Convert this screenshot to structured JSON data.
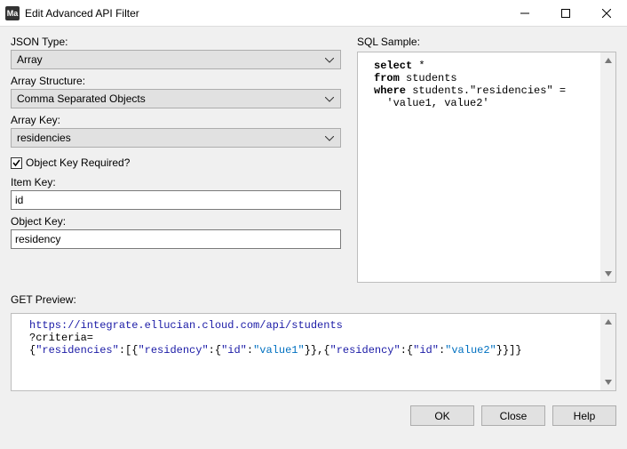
{
  "window": {
    "app_icon_text": "Ma",
    "title": "Edit Advanced API Filter"
  },
  "labels": {
    "json_type": "JSON Type:",
    "array_structure": "Array Structure:",
    "array_key": "Array Key:",
    "object_key_required": "Object Key Required?",
    "item_key": "Item Key:",
    "object_key": "Object Key:",
    "sql_sample": "SQL Sample:",
    "get_preview": "GET Preview:"
  },
  "fields": {
    "json_type": "Array",
    "array_structure": "Comma Separated Objects",
    "array_key": "residencies",
    "object_key_required_checked": true,
    "item_key": "id",
    "object_key": "residency"
  },
  "sql_sample": {
    "line1_kw": "select",
    "line1_rest": " *",
    "line2_kw": "from",
    "line2_rest": " students",
    "line3_kw": "where",
    "line3_rest": " students.\"residencies\" =",
    "line4": "  'value1, value2'"
  },
  "get_preview": {
    "base_url": "https://integrate.ellucian.cloud.com/api/students",
    "line2": "?criteria=",
    "json_text": "{\"residencies\":[{\"residency\":{\"id\":\"value1\"}},{\"residency\":{\"id\":\"value2\"}}]}"
  },
  "buttons": {
    "ok": "OK",
    "close": "Close",
    "help": "Help"
  }
}
